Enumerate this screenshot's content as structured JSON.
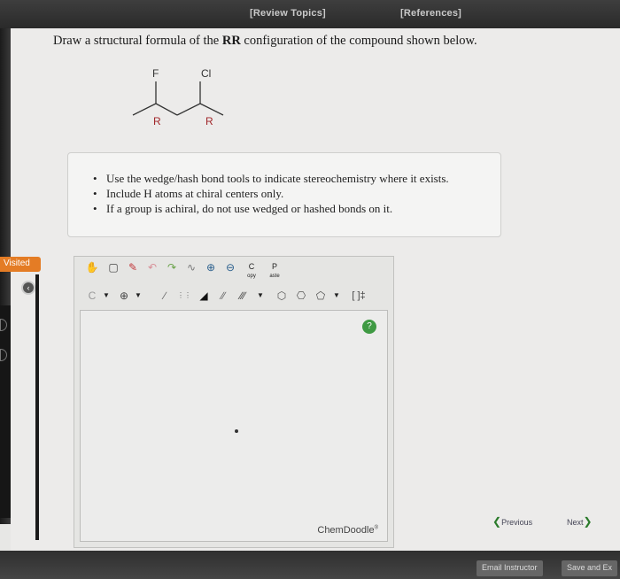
{
  "header": {
    "review_topics": "[Review Topics]",
    "references": "[References]"
  },
  "question": {
    "pre": "Draw a structural formula of the ",
    "bold": "RR",
    "post": " configuration of the compound shown below."
  },
  "molecule": {
    "substituent_left": "F",
    "substituent_right": "Cl",
    "label_left": "R",
    "label_right": "R"
  },
  "hints": [
    "Use the wedge/hash bond tools to indicate stereochemistry where it exists.",
    "Include H atoms at chiral centers only.",
    "If a group is achiral, do not use wedged or hashed bonds on it."
  ],
  "sidebar": {
    "visited_label": "Visited"
  },
  "chemdoodle": {
    "toolbar1": {
      "copy_top": "C",
      "copy_bottom": "opy",
      "paste_top": "P",
      "paste_bottom": "aste"
    },
    "toolbar2": {
      "carbon_label": "C",
      "charge_label": "[ ]‡"
    },
    "help_symbol": "?",
    "brand": "ChemDoodle",
    "brand_mark": "®"
  },
  "navigation": {
    "previous": "Previous",
    "next": "Next"
  },
  "footer": {
    "email_instructor": "Email Instructor",
    "save_and_exit": "Save and Ex"
  },
  "colors": {
    "accent_orange": "#e47c25",
    "help_green": "#3f9a43",
    "rs_label_red": "#a0262a"
  }
}
